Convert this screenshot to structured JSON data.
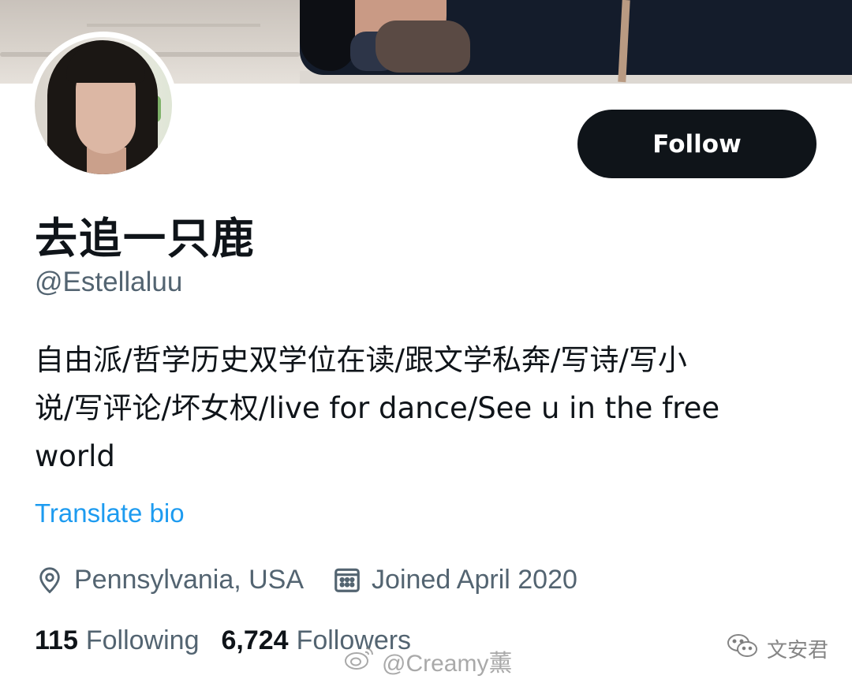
{
  "profile": {
    "display_name": "去追一只鹿",
    "handle": "@Estellaluu",
    "bio_lines": [
      "自由派/哲学历史双学位在读/跟文学私奔/写诗/写小",
      "说/写评论/坏女权/live for dance/See u in the free",
      "world"
    ],
    "translate_label": "Translate bio",
    "location": "Pennsylvania, USA",
    "joined": "Joined April 2020",
    "following_count": "115",
    "following_label": "Following",
    "followers_count": "6,724",
    "followers_label": "Followers"
  },
  "actions": {
    "follow_label": "Follow"
  },
  "watermarks": {
    "weibo": "@Creamy薰",
    "wechat": "文安君"
  },
  "icons": {
    "location": "map-pin-icon",
    "calendar": "calendar-icon",
    "weibo": "weibo-icon",
    "wechat": "wechat-icon"
  },
  "colors": {
    "accent": "#1d9bf0",
    "text": "#0f1419",
    "secondary": "#536471",
    "button_bg": "#0f1419"
  }
}
